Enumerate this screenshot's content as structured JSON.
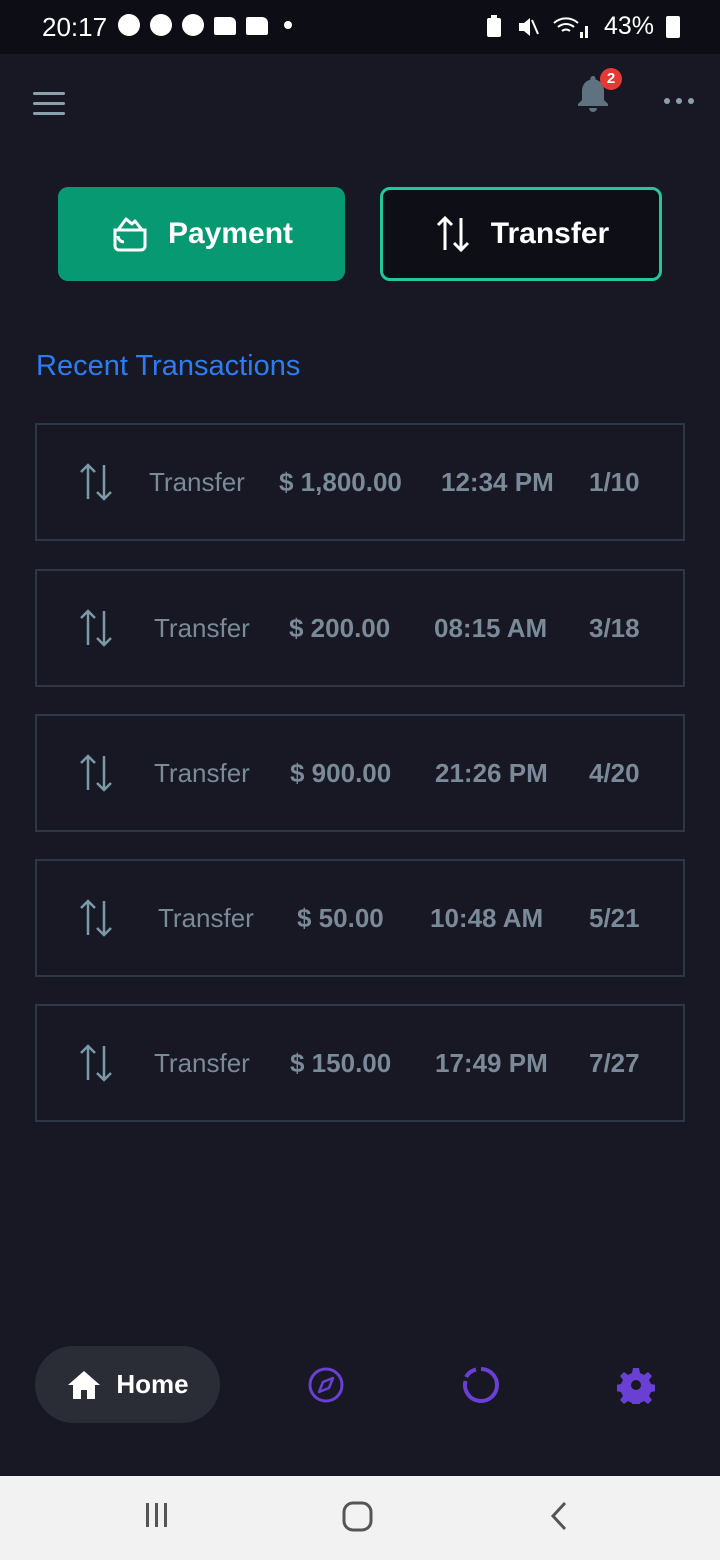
{
  "status_bar": {
    "time": "20:17",
    "battery": "43%"
  },
  "header": {
    "notification_count": "2"
  },
  "actions": {
    "payment_label": "Payment",
    "transfer_label": "Transfer"
  },
  "recent": {
    "title": "Recent Transactions",
    "transactions": [
      {
        "type": "Transfer",
        "amount": "$ 1,800.00",
        "time": "12:34 PM",
        "date": "1/10"
      },
      {
        "type": "Transfer",
        "amount": "$ 200.00",
        "time": "08:15 AM",
        "date": "3/18"
      },
      {
        "type": "Transfer",
        "amount": "$ 900.00",
        "time": "21:26 PM",
        "date": "4/20"
      },
      {
        "type": "Transfer",
        "amount": "$ 50.00",
        "time": "10:48 AM",
        "date": "5/21"
      },
      {
        "type": "Transfer",
        "amount": "$ 150.00",
        "time": "17:49 PM",
        "date": "7/27"
      }
    ]
  },
  "bottom_nav": {
    "home_label": "Home",
    "icons": [
      "home-icon",
      "compass-icon",
      "loader-icon",
      "gear-icon"
    ]
  },
  "colors": {
    "background": "#171823",
    "accent_green": "#079a72",
    "accent_teal": "#20c997",
    "link_blue": "#2d7df0",
    "nav_purple": "#6a3fd4"
  }
}
